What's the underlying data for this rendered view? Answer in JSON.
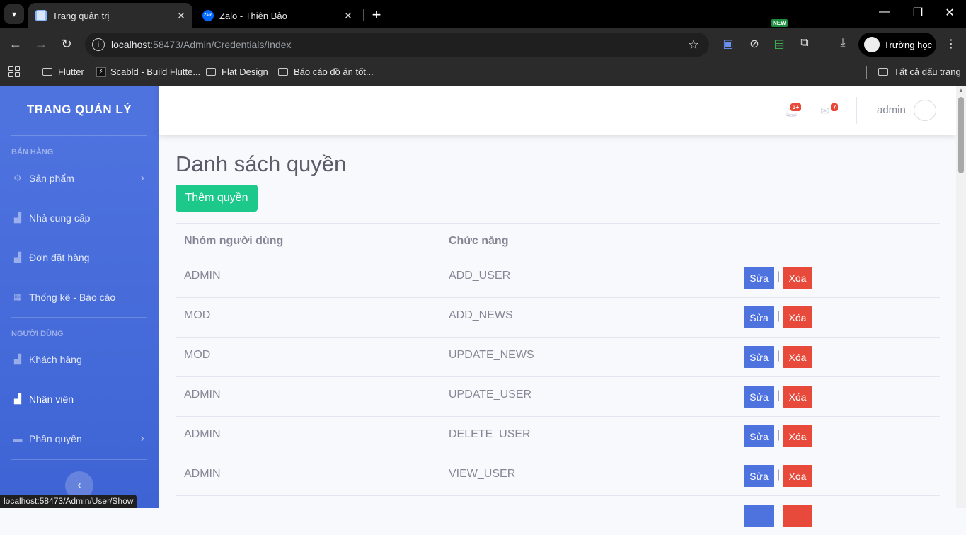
{
  "browser": {
    "tabs": [
      {
        "title": "Trang quản trị",
        "active": true
      },
      {
        "title": "Zalo - Thiên Bảo",
        "active": false
      }
    ],
    "url_host": "localhost",
    "url_path": ":58473/Admin/Credentials/Index",
    "profile_name": "Trường học",
    "new_badge": "NEW",
    "bookmarks": [
      "Flutter",
      "Scabld - Build Flutte...",
      "Flat Design",
      "Báo cáo đồ án tốt...",
      "Tất cả dấu trang"
    ],
    "status_url": "localhost:58473/Admin/User/Show"
  },
  "sidebar": {
    "brand": "TRANG QUẢN LÝ",
    "sections": [
      {
        "heading": "BÁN HÀNG",
        "items": [
          {
            "label": "Sản phẩm",
            "icon": "gear-icon",
            "chevron": true
          },
          {
            "label": "Nhà cung cấp",
            "icon": "chart-area-icon"
          },
          {
            "label": "Đơn đặt hàng",
            "icon": "chart-area-icon"
          },
          {
            "label": "Thống kê - Báo cáo",
            "icon": "table-icon"
          }
        ]
      },
      {
        "heading": "NGƯỜI DÙNG",
        "items": [
          {
            "label": "Khách hàng",
            "icon": "chart-area-icon"
          },
          {
            "label": "Nhân viên",
            "icon": "chart-area-icon",
            "active": true
          },
          {
            "label": "Phân quyền",
            "icon": "folder-icon",
            "chevron": true
          }
        ]
      }
    ]
  },
  "topbar": {
    "alerts_count": "3+",
    "messages_count": "7",
    "username": "admin"
  },
  "main": {
    "title": "Danh sách quyền",
    "add_button": "Thêm quyền",
    "columns": [
      "Nhóm người dùng",
      "Chức năng"
    ],
    "edit_label": "Sửa",
    "delete_label": "Xóa",
    "separator": "|",
    "rows": [
      {
        "group": "ADMIN",
        "function": "ADD_USER"
      },
      {
        "group": "MOD",
        "function": "ADD_NEWS"
      },
      {
        "group": "MOD",
        "function": "UPDATE_NEWS"
      },
      {
        "group": "ADMIN",
        "function": "UPDATE_USER"
      },
      {
        "group": "ADMIN",
        "function": "DELETE_USER"
      },
      {
        "group": "ADMIN",
        "function": "VIEW_USER"
      }
    ]
  },
  "colors": {
    "sidebar": "#4e73df",
    "success": "#1cc88a",
    "primary": "#4e73df",
    "danger": "#e74a3b"
  }
}
